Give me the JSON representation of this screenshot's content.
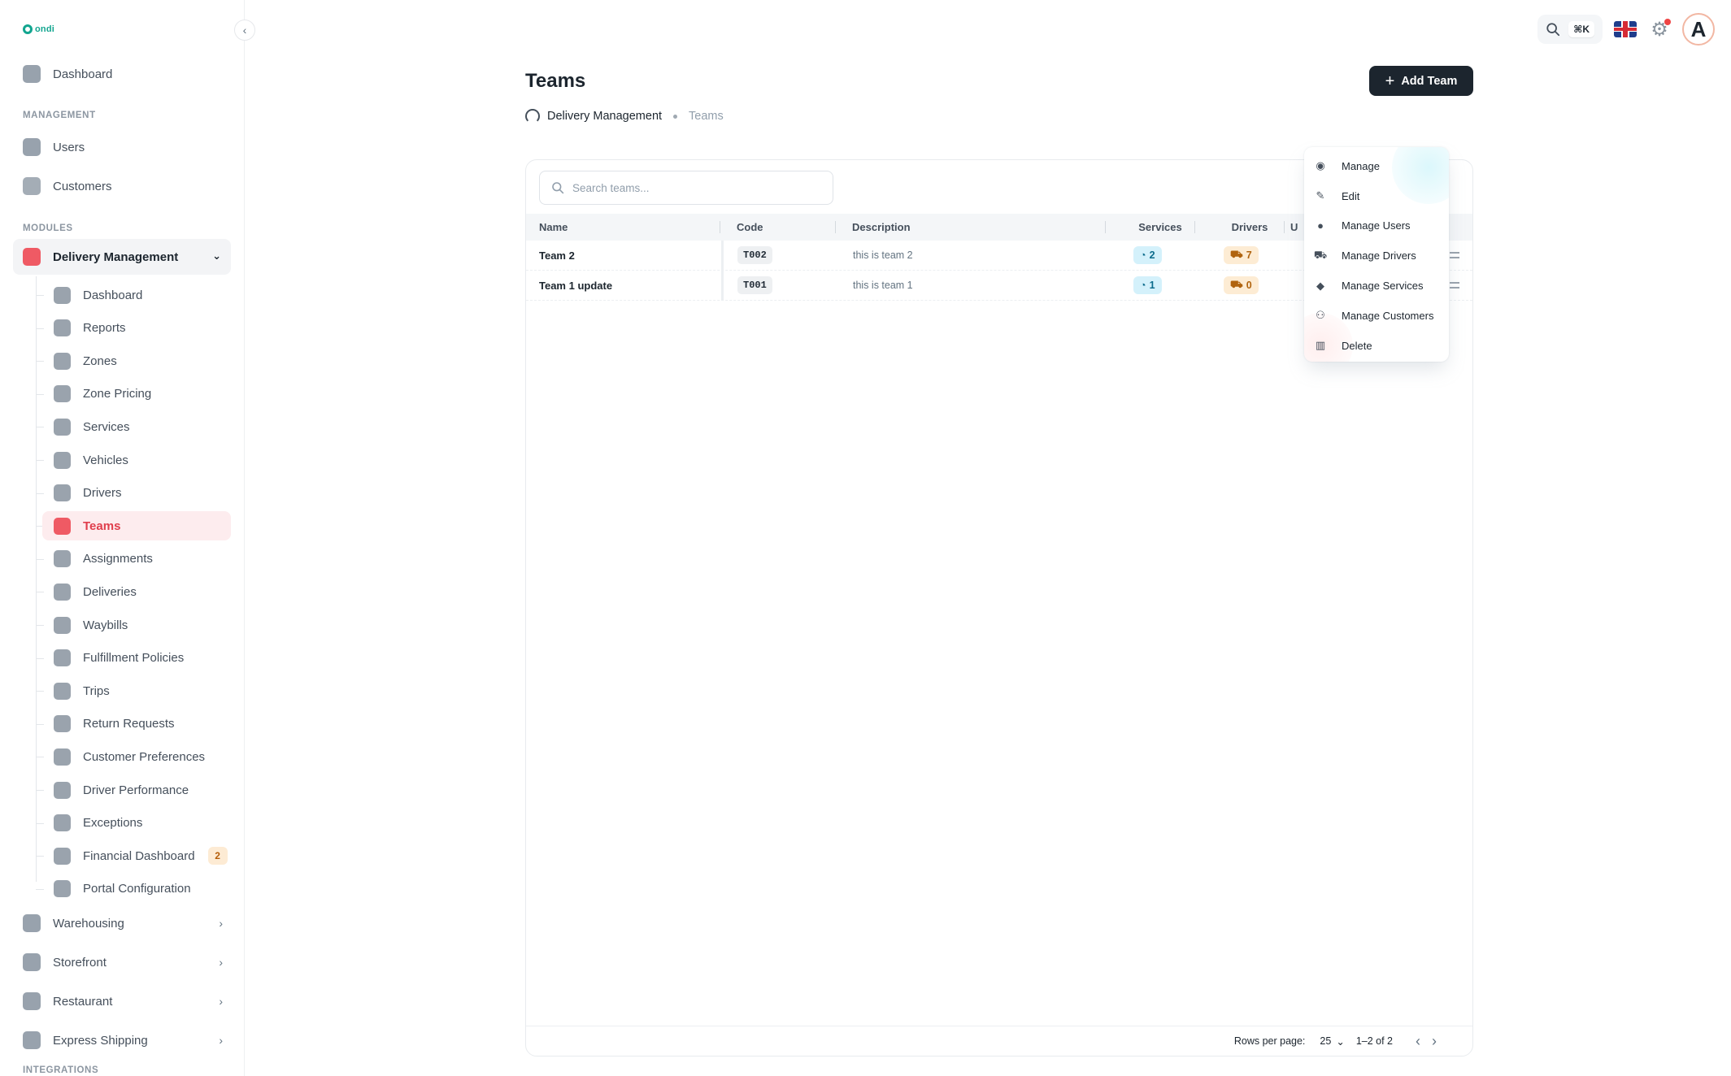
{
  "brand": {
    "name": "ondi",
    "color": "#12a58f"
  },
  "header": {
    "search_shortcut": "⌘K",
    "language": "English (UK)",
    "avatar_letter": "A"
  },
  "sidebar": {
    "dashboard": "Dashboard",
    "management_label": "MANAGEMENT",
    "users": "Users",
    "customers": "Customers",
    "modules_label": "MODULES",
    "delivery_group": "Delivery Management",
    "delivery_items": [
      {
        "label": "Dashboard"
      },
      {
        "label": "Reports"
      },
      {
        "label": "Zones"
      },
      {
        "label": "Zone Pricing"
      },
      {
        "label": "Services"
      },
      {
        "label": "Vehicles"
      },
      {
        "label": "Drivers"
      },
      {
        "label": "Teams"
      },
      {
        "label": "Assignments"
      },
      {
        "label": "Deliveries"
      },
      {
        "label": "Waybills"
      },
      {
        "label": "Fulfillment Policies"
      },
      {
        "label": "Trips"
      },
      {
        "label": "Return Requests"
      },
      {
        "label": "Customer Preferences"
      },
      {
        "label": "Driver Performance"
      },
      {
        "label": "Exceptions"
      },
      {
        "label": "Financial Dashboard",
        "badge": "2"
      },
      {
        "label": "Portal Configuration"
      }
    ],
    "groups": [
      "Warehousing",
      "Storefront",
      "Restaurant",
      "Express Shipping"
    ],
    "integrations_label": "INTEGRATIONS"
  },
  "page": {
    "title": "Teams",
    "add_button": "Add Team",
    "breadcrumb": [
      "Delivery Management",
      "Teams"
    ]
  },
  "table": {
    "search_placeholder": "Search teams...",
    "columns": [
      "Name",
      "Code",
      "Description",
      "Services",
      "Drivers",
      "U"
    ],
    "rows": [
      {
        "name": "Team 2",
        "code": "T002",
        "description": "this is team 2",
        "services": "2",
        "drivers": "7"
      },
      {
        "name": "Team 1 update",
        "code": "T001",
        "description": "this is team 1",
        "services": "1",
        "drivers": "0"
      }
    ],
    "footer": {
      "rows_per_page_label": "Rows per page:",
      "rows_per_page": "25",
      "range": "1–2 of 2"
    }
  },
  "context_menu": {
    "items": [
      "Manage",
      "Edit",
      "Manage Users",
      "Manage Drivers",
      "Manage Services",
      "Manage Customers",
      "Delete"
    ]
  },
  "colors": {
    "active": "#e03e4c",
    "active_bg": "#fdecee",
    "primary_button": "#1c252e",
    "services_chip": "#d4f1fb",
    "drivers_chip": "#fdecd4"
  }
}
